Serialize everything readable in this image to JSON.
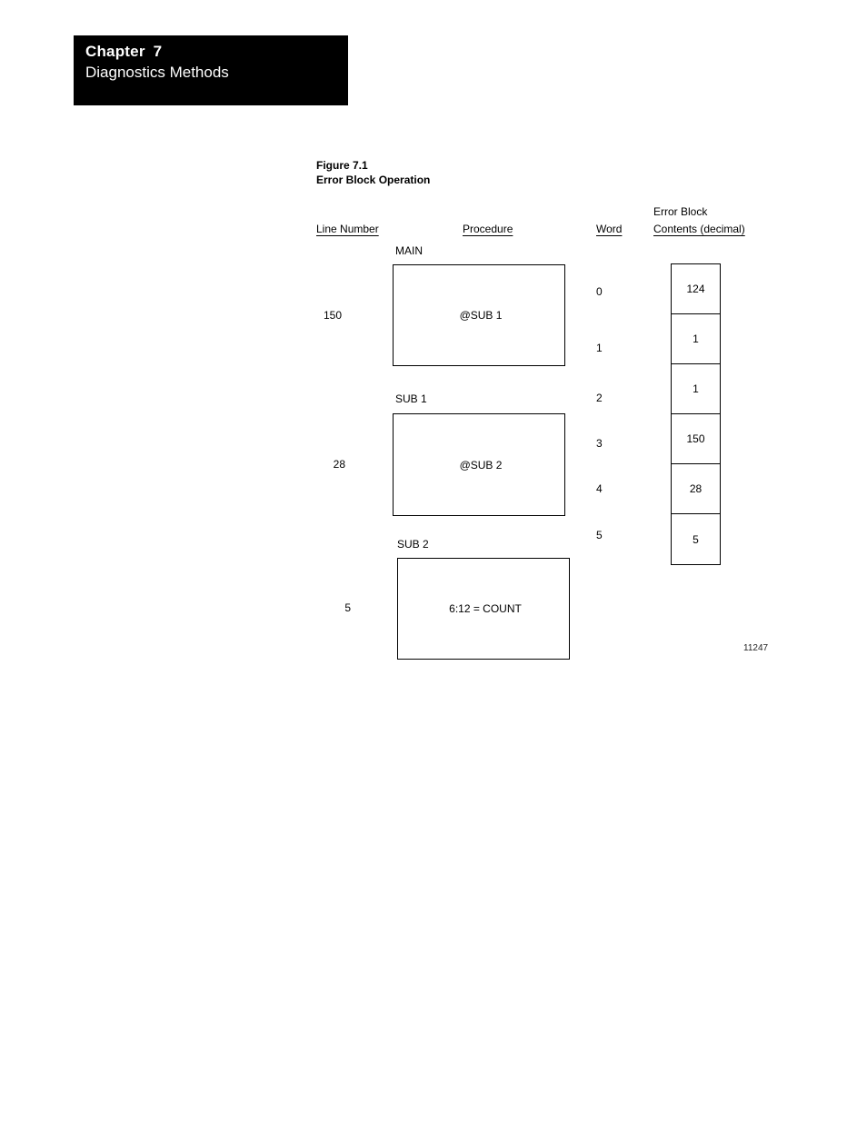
{
  "header": {
    "chapter_label": "Chapter",
    "chapter_number": "7",
    "chapter_title": "Diagnostics Methods"
  },
  "figure": {
    "number": "Figure 7.1",
    "title": "Error Block Operation",
    "drawing_reference": "11247"
  },
  "columns": {
    "line_number": "Line Number",
    "procedure": "Procedure",
    "word": "Word",
    "error_block_line1": "Error Block",
    "error_block_line2": "Contents (decimal)"
  },
  "procedures": [
    {
      "label": "MAIN",
      "line_number": "150",
      "statement": "@SUB 1"
    },
    {
      "label": "SUB 1",
      "line_number": "28",
      "statement": "@SUB 2"
    },
    {
      "label": "SUB 2",
      "line_number": "5",
      "statement": "6:12 = COUNT"
    }
  ],
  "error_block": {
    "words": [
      "0",
      "1",
      "2",
      "3",
      "4",
      "5"
    ],
    "contents": [
      "124",
      "1",
      "1",
      "150",
      "28",
      "5"
    ]
  },
  "colors": {
    "banner_background": "#000000",
    "banner_text": "#ffffff",
    "page_background": "#ffffff",
    "ink": "#000000"
  }
}
